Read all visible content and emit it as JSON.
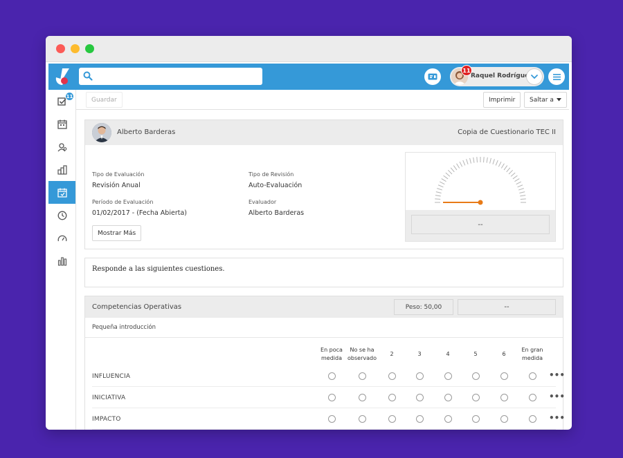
{
  "search": {
    "value": "",
    "placeholder": ""
  },
  "user": {
    "name": "Raquel Rodríguez",
    "notifications": "11"
  },
  "sidebar": {
    "tasks_badge": "11"
  },
  "toolbar": {
    "save_label": "Guardar",
    "print_label": "Imprimir",
    "jump_label": "Saltar a"
  },
  "evaluation": {
    "person_name": "Alberto Barderas",
    "questionnaire": "Copia de Cuestionario TEC II",
    "type_label": "Tipo de Evaluación",
    "type_value": "Revisión Anual",
    "review_label": "Tipo de Revisión",
    "review_value": "Auto-Evaluación",
    "period_label": "Período de Evaluación",
    "period_value": "01/02/2017 - (Fecha Abierta)",
    "evaluator_label": "Evaluador",
    "evaluator_value": "Alberto Barderas",
    "show_more_label": "Mostrar Más",
    "gauge_value": "--"
  },
  "instructions": "Responde a las siguientes cuestiones.",
  "competency": {
    "title": "Competencias Operativas",
    "weight": "Peso: 50,00",
    "score": "--",
    "intro": "Pequeña introducción",
    "scale": [
      {
        "l1": "En poca",
        "l2": "medida"
      },
      {
        "l1": "No se ha",
        "l2": "observado"
      },
      {
        "l1": "2",
        "l2": ""
      },
      {
        "l1": "3",
        "l2": ""
      },
      {
        "l1": "4",
        "l2": ""
      },
      {
        "l1": "5",
        "l2": ""
      },
      {
        "l1": "6",
        "l2": ""
      },
      {
        "l1": "En gran",
        "l2": "medida"
      }
    ],
    "questions": [
      "INFLUENCIA",
      "INICIATIVA",
      "IMPACTO"
    ],
    "more_label": "•••"
  }
}
